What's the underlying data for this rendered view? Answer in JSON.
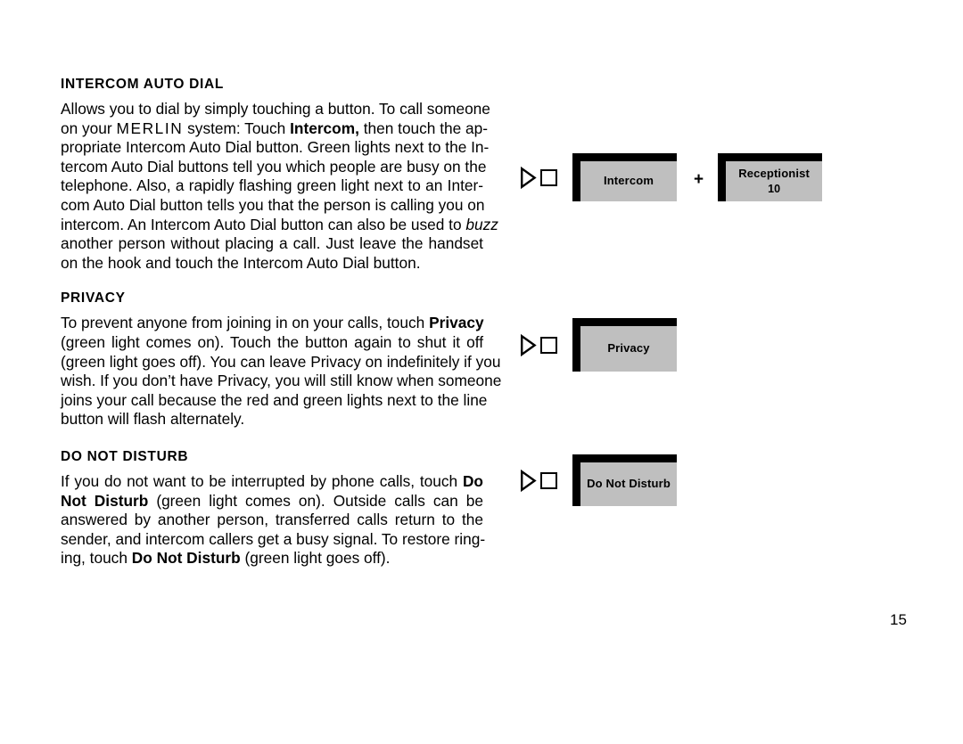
{
  "page": {
    "number": "15",
    "background_color": "#ffffff",
    "button_fill_color": "#bfbfbf",
    "button_border_color": "#000000"
  },
  "sections": [
    {
      "id": "intercom-auto-dial",
      "heading": "INTERCOM AUTO DIAL",
      "lines": [
        "Allows you to dial by simply touching a button. To call someone",
        "on your MERLIN system: Touch Intercom, then touch the ap-",
        "propriate Intercom Auto Dial button. Green lights next to the In-",
        "tercom Auto Dial buttons tell you which people are busy on the",
        "telephone. Also, a rapidly flashing green light next to an Inter-",
        "com Auto Dial button tells you that the person is calling you on",
        "intercom. An Intercom Auto Dial button can also be used to buzz",
        "another person without placing a call. Just leave the handset",
        "on the hook and touch the Intercom Auto Dial button."
      ],
      "full_text": "Allows you to dial by simply touching a button. To call someone on your MERLIN system: Touch Intercom, then touch the appropriate Intercom Auto Dial button. Green lights next to the Intercom Auto Dial buttons tell you which people are busy on the telephone. Also, a rapidly flashing green light next to an Intercom Auto Dial button tells you that the person is calling you on intercom. An Intercom Auto Dial button can also be used to buzz another person without placing a call. Just leave the handset on the hook and touch the Intercom Auto Dial button."
    },
    {
      "id": "privacy",
      "heading": "PRIVACY",
      "lines": [
        "To prevent anyone from joining in on your calls, touch Privacy",
        "(green light comes on). Touch the button again to shut it off",
        "(green light goes off). You can leave Privacy on indefinitely if you",
        "wish. If you don’t have Privacy, you will still know when someone",
        "joins your call because the red and green lights next to the line",
        "button will flash alternately."
      ],
      "full_text": "To prevent anyone from joining in on your calls, touch Privacy (green light comes on). Touch the button again to shut it off (green light goes off). You can leave Privacy on indefinitely if you wish. If you don’t have Privacy, you will still know when someone joins your call because the red and green lights next to the line button will flash alternately."
    },
    {
      "id": "do-not-disturb",
      "heading": "DO NOT DISTURB",
      "lines": [
        "If you do not want to be interrupted by phone calls, touch Do",
        "Not Disturb (green light comes on). Outside calls can be",
        "answered by another person, transferred calls return to the",
        "sender, and intercom callers get a busy signal. To restore ring-",
        "ing, touch Do Not Disturb (green light goes off)."
      ],
      "full_text": "If you do not want to be interrupted by phone calls, touch Do Not Disturb (green light comes on). Outside calls can be answered by another person, transferred calls return to the sender, and intercom callers get a busy signal. To restore ringing, touch Do Not Disturb (green light goes off)."
    }
  ],
  "diagrams": [
    {
      "id": "intercom-diagram",
      "indicator_icons": [
        "triangle-right-icon",
        "square-outline-icon"
      ],
      "operator": "+",
      "buttons": [
        {
          "label": "Intercom",
          "sub": ""
        },
        {
          "label": "Receptionist",
          "sub": "10"
        }
      ]
    },
    {
      "id": "privacy-diagram",
      "indicator_icons": [
        "triangle-right-icon",
        "square-outline-icon"
      ],
      "operator": "",
      "buttons": [
        {
          "label": "Privacy",
          "sub": ""
        }
      ]
    },
    {
      "id": "do-not-disturb-diagram",
      "indicator_icons": [
        "triangle-right-icon",
        "square-outline-icon"
      ],
      "operator": "",
      "buttons": [
        {
          "label": "Do Not Disturb",
          "sub": ""
        }
      ]
    }
  ]
}
